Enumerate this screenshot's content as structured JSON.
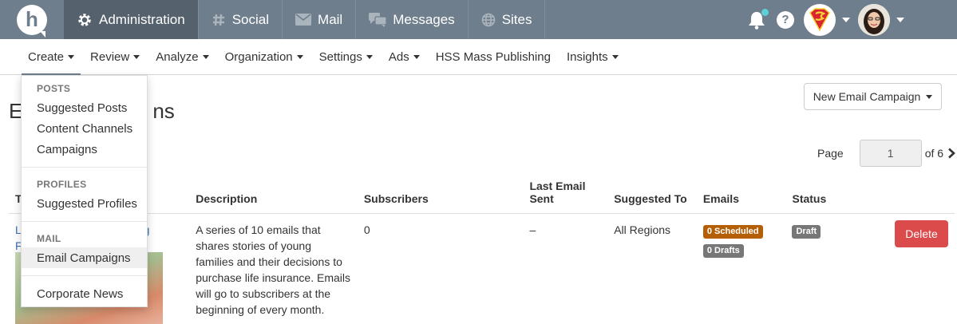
{
  "topbar": {
    "logo_letter": "h",
    "tabs": [
      {
        "label": "Administration",
        "icon": "gear-icon"
      },
      {
        "label": "Social",
        "icon": "hashtag-icon"
      },
      {
        "label": "Mail",
        "icon": "envelope-icon"
      },
      {
        "label": "Messages",
        "icon": "chat-icon"
      },
      {
        "label": "Sites",
        "icon": "globe-icon"
      }
    ],
    "help": "?",
    "colors": {
      "bar": "#6e7e8c",
      "active_tab": "#55626d",
      "notification_dot": "#5cd1d6"
    }
  },
  "subnav": {
    "items": [
      {
        "label": "Create",
        "has_menu": true
      },
      {
        "label": "Review",
        "has_menu": true
      },
      {
        "label": "Analyze",
        "has_menu": true
      },
      {
        "label": "Organization",
        "has_menu": true
      },
      {
        "label": "Settings",
        "has_menu": true
      },
      {
        "label": "Ads",
        "has_menu": true
      },
      {
        "label": "HSS Mass Publishing",
        "has_menu": false
      },
      {
        "label": "Insights",
        "has_menu": true
      }
    ]
  },
  "dropdown": {
    "sections": [
      {
        "header": "POSTS",
        "items": [
          "Suggested Posts",
          "Content Channels",
          "Campaigns"
        ]
      },
      {
        "header": "PROFILES",
        "items": [
          "Suggested Profiles"
        ]
      },
      {
        "header": "MAIL",
        "items": [
          "Email Campaigns"
        ]
      },
      {
        "header": "",
        "items": [
          "Corporate News"
        ]
      }
    ],
    "highlighted": "Email Campaigns"
  },
  "page": {
    "title_start": "E",
    "title_end": "ns",
    "new_button": "New Email Campaign",
    "pager": {
      "label": "Page",
      "current": "1",
      "of": "of 6"
    }
  },
  "table": {
    "columns": [
      "T",
      "Description",
      "Subscribers",
      "Last Email Sent",
      "Suggested To",
      "Emails",
      "Status"
    ],
    "rows": [
      {
        "title_start": "L",
        "title_end": "ng",
        "title_line2": "F",
        "description": "A series of 10 emails that shares stories of young families and their decisions to purchase life insurance. Emails will go to subscribers at the beginning of every month.",
        "subscribers": "0",
        "last_email_sent": "–",
        "suggested_to": "All Regions",
        "emails": [
          "0 Scheduled",
          "0 Drafts"
        ],
        "status": "Draft",
        "action": "Delete"
      }
    ]
  }
}
